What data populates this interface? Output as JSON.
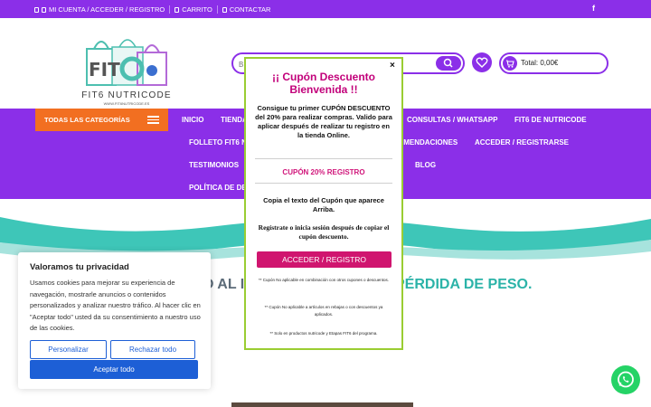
{
  "topbar": {
    "links": [
      "MI CUENTA / ACCEDER / REGISTRO",
      "CARRITO",
      "CONTACTAR"
    ],
    "social": "f"
  },
  "header": {
    "logo_text": "FIT6 NUTRICODE",
    "logo_sub": "WWW.FIT6NUTRICODE.ES",
    "search_placeholder": "B",
    "cart_label": "Total: 0,00€"
  },
  "nav": {
    "categories_label": "TODAS LAS CATEGORÍAS",
    "items_row1": [
      "INICIO",
      "TIENDA",
      "CONSULTAS / WHATSAPP",
      "FIT6 DE NUTRICODE"
    ],
    "items_row2": [
      "FOLLETO FIT6 N",
      "OMENDACIONES",
      "ACCEDER / REGISTRARSE"
    ],
    "items_row3": [
      "TESTIMONIOS",
      "BLOG"
    ],
    "items_row4": [
      "POLÍTICA DE DE"
    ]
  },
  "hero": {
    "title_left": "O AL IN",
    "title_right": "PÉRDIDA DE PESO."
  },
  "cookie": {
    "title": "Valoramos tu privacidad",
    "text": "Usamos cookies para mejorar su experiencia de navegación, mostrarle anuncios o contenidos personalizados y analizar nuestro tráfico. Al hacer clic en \"Aceptar todo\" usted da su consentimiento a nuestro uso de las cookies.",
    "customize": "Personalizar",
    "reject": "Rechazar todo",
    "accept": "Aceptar todo"
  },
  "popup": {
    "close": "×",
    "title": "¡¡ Cupón Descuento Bienvenida !!",
    "intro": "Consigue tu primer CUPÓN DESCUENTO del 20% para realizar compras. Valido para aplicar después de realizar tu registro en la tienda Online.",
    "code": "CUPÓN 20% REGISTRO",
    "copy_text": "Copia el texto del Cupón que aparece Arriba.",
    "register_text": "Regístrate o inicia sesión después de copiar el cupón descuento.",
    "button": "ACCEDER / REGISTRO",
    "note1": "** Cupón No aplicable en combinación con otros cupones o descuentos.",
    "note2": "** Cupón No aplicable a artículos en rebajas o con descuentos ya aplicados.",
    "note3": "** Solo en productos nutricode y Etapas FIT6 del programa."
  },
  "colors": {
    "brand_purple": "#8b2fe8",
    "accent_orange": "#f26f21",
    "popup_pink": "#d0156f",
    "popup_border": "#9acd32",
    "cookie_blue": "#1d5fd6",
    "teal": "#2bb3a8",
    "whatsapp_green": "#25d366"
  },
  "icons": [
    "user-icon",
    "cart-icon",
    "mail-icon",
    "facebook-icon",
    "search-icon",
    "heart-icon",
    "hamburger-icon",
    "close-icon",
    "whatsapp-icon"
  ]
}
